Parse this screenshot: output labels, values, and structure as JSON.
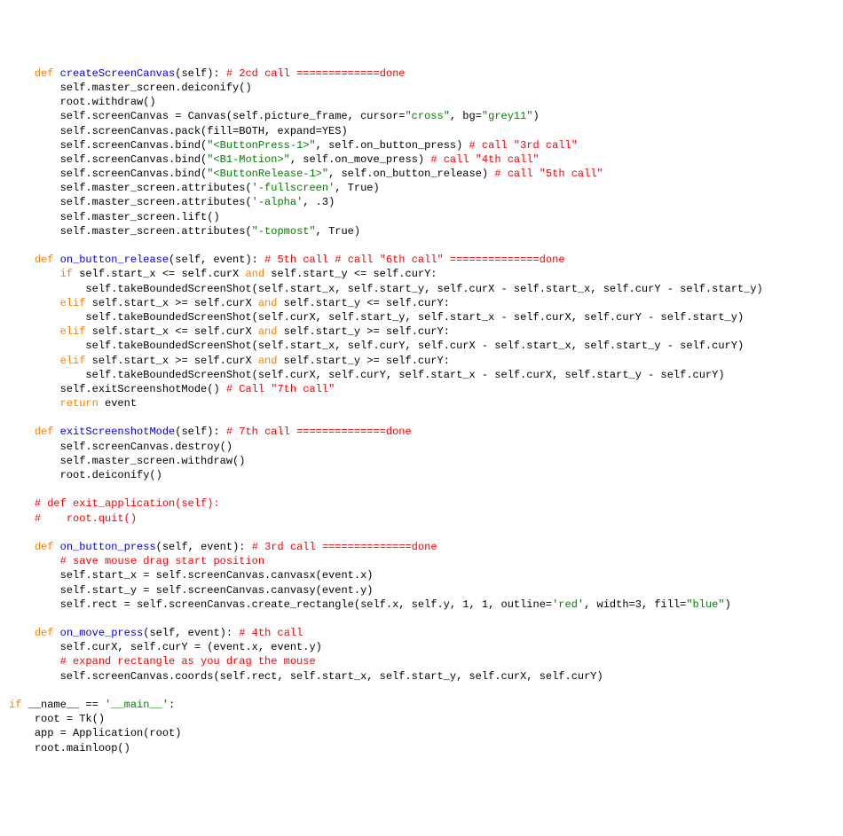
{
  "lang": "python",
  "indent": "    ",
  "code": {
    "l1": {
      "k": "def ",
      "f": "createScreenCanvas",
      "p": "(self): ",
      "c": "# 2cd call =============done"
    },
    "l2": "self.master_screen.deiconify()",
    "l3": "root.withdraw()",
    "l4": {
      "a": "self.screenCanvas = Canvas(self.picture_frame, cursor=",
      "s1": "\"cross\"",
      "b": ", bg=",
      "s2": "\"grey11\"",
      "c": ")"
    },
    "l5": "self.screenCanvas.pack(fill=BOTH, expand=YES)",
    "l6": {
      "a": "self.screenCanvas.bind(",
      "s": "\"<ButtonPress-1>\"",
      "b": ", self.on_button_press) ",
      "c": "# call \"3rd call\""
    },
    "l7": {
      "a": "self.screenCanvas.bind(",
      "s": "\"<B1-Motion>\"",
      "b": ", self.on_move_press) ",
      "c": "# call \"4th call\""
    },
    "l8": {
      "a": "self.screenCanvas.bind(",
      "s": "\"<ButtonRelease-1>\"",
      "b": ", self.on_button_release) ",
      "c": "# call \"5th call\""
    },
    "l9": {
      "a": "self.master_screen.attributes(",
      "s": "'-fullscreen'",
      "b": ", True)"
    },
    "l10": {
      "a": "self.master_screen.attributes(",
      "s": "'-alpha'",
      "b": ", .3)"
    },
    "l11": "self.master_screen.lift()",
    "l12": {
      "a": "self.master_screen.attributes(",
      "s": "\"-topmost\"",
      "b": ", True)"
    },
    "l13": {
      "k": "def ",
      "f": "on_button_release",
      "p": "(self, event): ",
      "c": "# 5th call # call \"6th call\" ==============done"
    },
    "l14": {
      "k": "if ",
      "a": "self.start_x <= self.curX ",
      "kand": "and ",
      "b": "self.start_y <= self.curY:"
    },
    "l15": "self.takeBoundedScreenShot(self.start_x, self.start_y, self.curX - self.start_x, self.curY - self.start_y)",
    "l16": {
      "k": "elif ",
      "a": "self.start_x >= self.curX ",
      "kand": "and ",
      "b": "self.start_y <= self.curY:"
    },
    "l17": "self.takeBoundedScreenShot(self.curX, self.start_y, self.start_x - self.curX, self.curY - self.start_y)",
    "l18": {
      "k": "elif ",
      "a": "self.start_x <= self.curX ",
      "kand": "and ",
      "b": "self.start_y >= self.curY:"
    },
    "l19": "self.takeBoundedScreenShot(self.start_x, self.curY, self.curX - self.start_x, self.start_y - self.curY)",
    "l20": {
      "k": "elif ",
      "a": "self.start_x >= self.curX ",
      "kand": "and ",
      "b": "self.start_y >= self.curY:"
    },
    "l21": "self.takeBoundedScreenShot(self.curX, self.curY, self.start_x - self.curX, self.start_y - self.curY)",
    "l22": {
      "a": "self.exitScreenshotMode() ",
      "c": "# Call \"7th call\""
    },
    "l23": {
      "k": "return ",
      "a": "event"
    },
    "l24": {
      "k": "def ",
      "f": "exitScreenshotMode",
      "p": "(self): ",
      "c": "# 7th call ==============done"
    },
    "l25": "self.screenCanvas.destroy()",
    "l26": "self.master_screen.withdraw()",
    "l27": "root.deiconify()",
    "l28": "# def exit_application(self):",
    "l29": "#    root.quit()",
    "l30": {
      "k": "def ",
      "f": "on_button_press",
      "p": "(self, event): ",
      "c": "# 3rd call ==============done"
    },
    "l31": "# save mouse drag start position",
    "l32": "self.start_x = self.screenCanvas.canvasx(event.x)",
    "l33": "self.start_y = self.screenCanvas.canvasy(event.y)",
    "l34": {
      "a": "self.rect = self.screenCanvas.create_rectangle(self.x, self.y, 1, 1, outline=",
      "s1": "'red'",
      "b": ", width=3, fill=",
      "s2": "\"blue\"",
      "c": ")"
    },
    "l35": {
      "k": "def ",
      "f": "on_move_press",
      "p": "(self, event): ",
      "c": "# 4th call"
    },
    "l36": "self.curX, self.curY = (event.x, event.y)",
    "l37": "# expand rectangle as you drag the mouse",
    "l38": "self.screenCanvas.coords(self.rect, self.start_x, self.start_y, self.curX, self.curY)",
    "l39": {
      "k": "if ",
      "a": "__name__ == ",
      "s": "'__main__'",
      "b": ":"
    },
    "l40": "root = Tk()",
    "l41": "app = Application(root)",
    "l42": "root.mainloop()"
  }
}
